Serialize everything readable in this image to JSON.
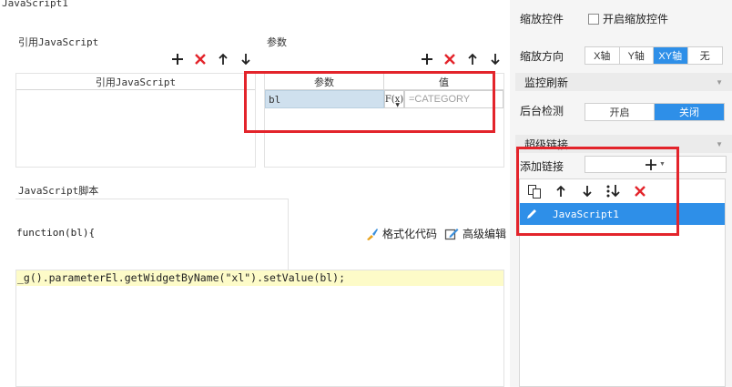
{
  "dialog": {
    "title": "JavaScript1",
    "ref_section_label": "引用JavaScript",
    "ref_table_header": "引用JavaScript",
    "params_section_label": "参数",
    "params_headers": [
      "参数",
      "值"
    ],
    "param_row": {
      "name": "bl",
      "formula_label": "F(x)",
      "value": "=CATEGORY"
    },
    "script_section_label": "JavaScript脚本",
    "function_header": "function(bl){",
    "format_code_label": "格式化代码",
    "advanced_edit_label": "高级编辑",
    "code_line": "_g().parameterEl.getWidgetByName(\"xl\").setValue(bl);"
  },
  "right_panel": {
    "zoom_control_label": "缩放控件",
    "enable_zoom_label": "开启缩放控件",
    "zoom_direction_label": "缩放方向",
    "zoom_options": [
      "X轴",
      "Y轴",
      "XY轴",
      "无"
    ],
    "zoom_selected": "XY轴",
    "monitor_refresh_label": "监控刷新",
    "bg_check_label": "后台检测",
    "bg_options": [
      "开启",
      "关闭"
    ],
    "bg_selected": "关闭",
    "hyperlink_label": "超级链接",
    "add_link_label": "添加链接",
    "link_items": [
      "JavaScript1"
    ]
  },
  "colors": {
    "accent": "#2e8fe8",
    "highlight_red": "#e3242b",
    "code_bg": "#fdfbc8",
    "param_cell_bg": "#cfe0ee"
  }
}
